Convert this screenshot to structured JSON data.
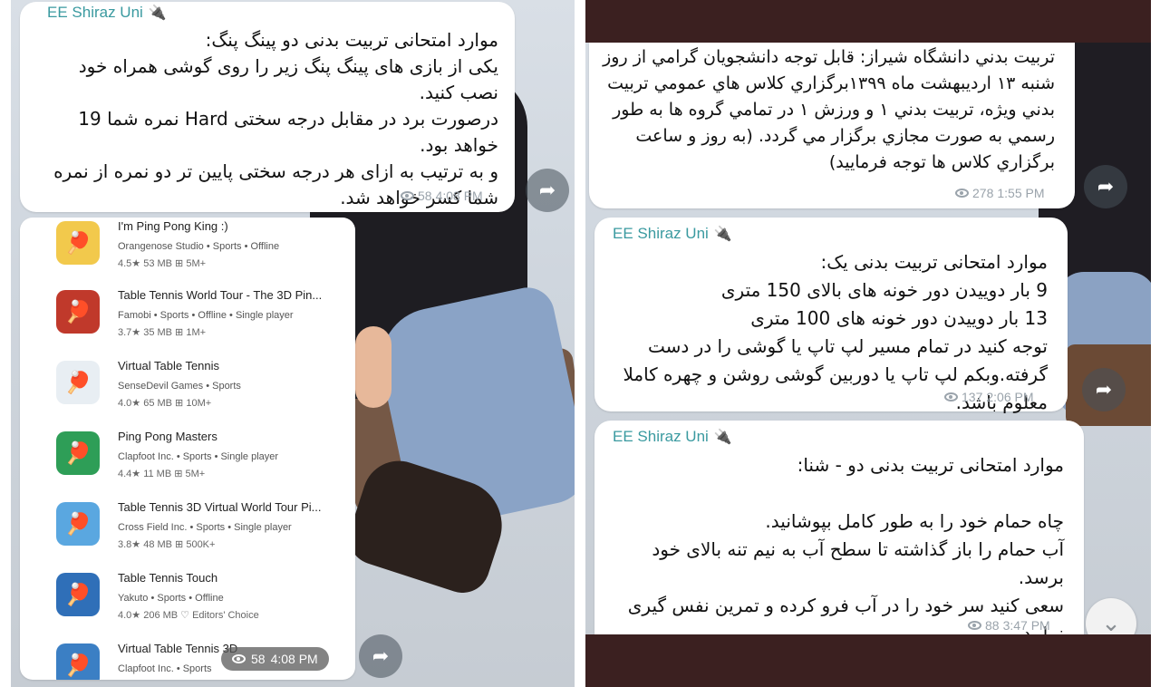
{
  "left": {
    "bubble1": {
      "sender": "EE Shiraz Uni",
      "text": "موارد امتحانی تربیت بدنی دو پینگ پنگ:\nیکی از بازی های پینگ پنگ زیر را روی گوشی همراه خود نصب کنید.\nدرصورت برد در مقابل درجه سختی Hard نمره شما 19 خواهد بود.\nو به ترتیب به ازای هر درجه سختی پایین تر دو نمره از نمره شما کسر خواهد شد.",
      "views": "58",
      "time": "4:08 PM"
    },
    "apps": [
      {
        "title": "I'm Ping Pong King :)",
        "dev": "Orangenose Studio • Sports • Offline",
        "stats": "4.5★  53 MB  ⊞ 5M+",
        "icon": "ping-pong-paddle-icon",
        "color": "#f2c94c"
      },
      {
        "title": "Table Tennis World Tour - The 3D Pin...",
        "dev": "Famobi • Sports • Offline • Single player",
        "stats": "3.7★  35 MB  ⊞ 1M+",
        "icon": "table-tennis-arena-icon",
        "color": "#c0392b"
      },
      {
        "title": "Virtual Table Tennis",
        "dev": "SenseDevil Games • Sports",
        "stats": "4.0★  65 MB  ⊞ 10M+",
        "icon": "red-paddle-icon",
        "color": "#e8eef3"
      },
      {
        "title": "Ping Pong Masters",
        "dev": "Clapfoot Inc. • Sports • Single player",
        "stats": "4.4★  11 MB  ⊞ 5M+",
        "icon": "paddle-ball-icon",
        "color": "#2e9e57"
      },
      {
        "title": "Table Tennis 3D Virtual World Tour Pi...",
        "dev": "Cross Field Inc. • Sports • Single player",
        "stats": "3.8★  48 MB  ⊞ 500K+",
        "icon": "blue-table-icon",
        "color": "#5aa7e0"
      },
      {
        "title": "Table Tennis Touch",
        "dev": "Yakuto • Sports • Offline",
        "stats": "4.0★  206 MB  ♡ Editors' Choice",
        "icon": "touch-paddle-icon",
        "color": "#2f6fb8"
      },
      {
        "title": "Virtual Table Tennis 3D",
        "dev": "Clapfoot Inc. • Sports",
        "stats": "",
        "icon": "paddle-3d-icon",
        "color": "#3b7fc4"
      }
    ],
    "image_meta": {
      "views": "58",
      "time": "4:08 PM"
    }
  },
  "right": {
    "bubble1": {
      "text": "تربيت بدني دانشگاه شيراز: قابل توجه دانشجويان گرامي از روز شنبه ۱۳ ارديبهشت ماه ۱۳۹۹برگزاري كلاس هاي عمومي تربيت بدني ويژه، تربيت بدني ۱ و ورزش ۱ در تمامي گروه ها به طور رسمي به صورت مجازي برگزار مي گردد. (به روز و ساعت برگزاري كلاس ها توجه فرماييد)",
      "views": "278",
      "time": "1:55 PM"
    },
    "bubble2": {
      "sender": "EE Shiraz Uni",
      "text": "موارد امتحانی تربیت بدنی یک:\n9 بار دوییدن دور خونه های بالای 150 متری\n13 بار دوییدن دور خونه های 100 متری\nتوجه کنید در تمام مسیر لپ تاپ یا گوشی را در دست گرفته.وبکم لپ تاپ یا دوربین گوشی روشن و چهره کاملا معلوم باشد.",
      "views": "137",
      "time": "2:06 PM"
    },
    "bubble3": {
      "sender": "EE Shiraz Uni",
      "text": "موارد امتحانی تربیت بدنی دو - شنا:\n\nچاه حمام خود را به طور کامل بپوشانید.\nآب حمام را باز گذاشته تا سطح آب به نیم تنه بالای خود برسد.\nسعی کنید سر خود را در آب فرو کرده و تمرین نفس گیری نمایید.",
      "views": "88",
      "time": "3:47 PM"
    }
  },
  "icons": {
    "share": "share-arrow-icon",
    "views": "eye-icon",
    "plug": "plug-icon",
    "scroll": "chevron-down-icon"
  }
}
